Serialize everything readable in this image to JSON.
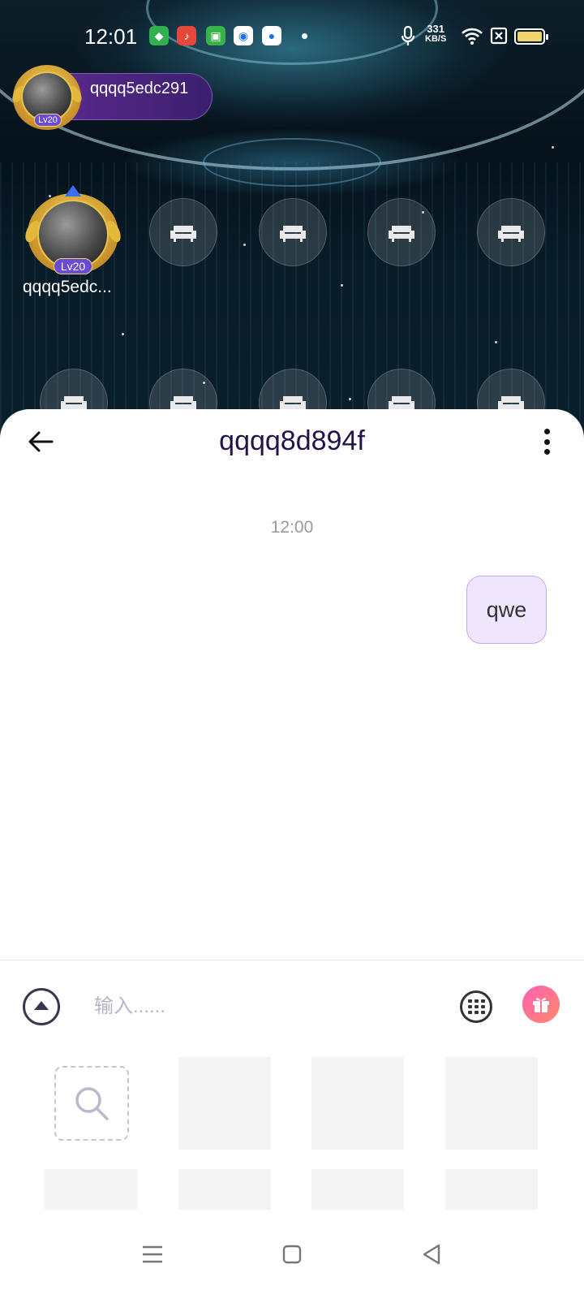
{
  "status_bar": {
    "time": "12:01",
    "net_speed_value": "331",
    "net_speed_unit": "KB/S",
    "icons": [
      "shield-app-icon",
      "music-app-icon",
      "shop-app-icon",
      "browser-app-icon",
      "camera-app-icon",
      "mic-icon",
      "wifi-icon",
      "sim-off-icon",
      "battery-icon"
    ],
    "battery_color": "#f3d36b"
  },
  "room": {
    "host": {
      "name": "qqqq5edc291",
      "level": "Lv20"
    },
    "seats": [
      {
        "name": "qqqq5edc...",
        "level": "Lv20",
        "occupied": true
      },
      {
        "occupied": false,
        "icon": "sofa-icon"
      },
      {
        "occupied": false,
        "icon": "sofa-icon"
      },
      {
        "occupied": false,
        "icon": "sofa-icon"
      },
      {
        "occupied": false,
        "icon": "sofa-icon"
      }
    ]
  },
  "chat": {
    "title": "qqqq8d894f",
    "messages": [
      {
        "time": "12:00",
        "text": "qwe",
        "outgoing": true
      }
    ],
    "input": {
      "placeholder": "输入......",
      "value": ""
    },
    "accent_color": "#c8a8f3",
    "title_color": "#24124a"
  },
  "nav_bar": {
    "buttons": [
      "menu-icon",
      "home-icon",
      "back-icon"
    ]
  }
}
